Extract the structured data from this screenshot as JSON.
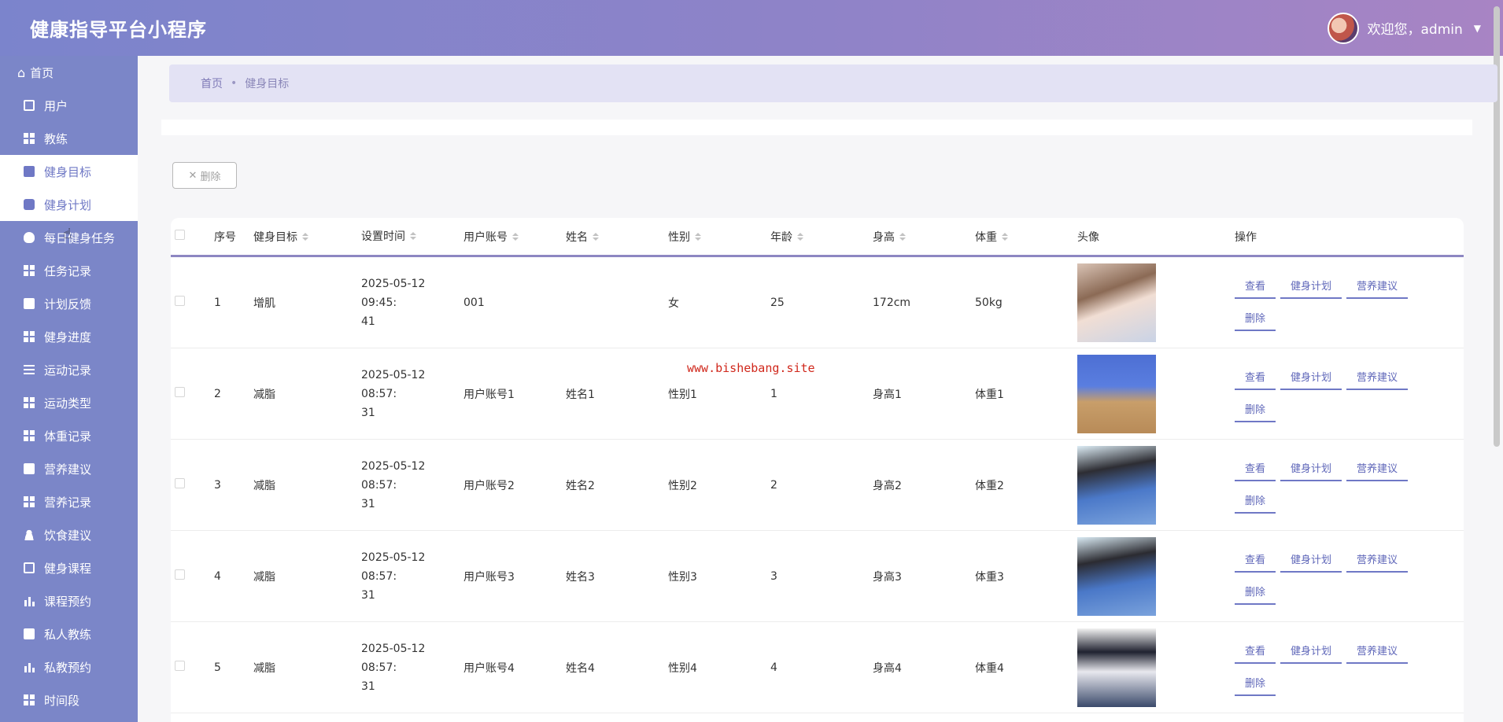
{
  "header": {
    "title": "健康指导平台小程序",
    "welcome": "欢迎您，admin"
  },
  "sidebar": {
    "home": "首页",
    "items": [
      {
        "label": "用户",
        "icon": "clipboard-icon"
      },
      {
        "label": "教练",
        "icon": "grid-icon"
      },
      {
        "label": "健身目标",
        "icon": "briefcase-icon"
      },
      {
        "label": "健身计划",
        "icon": "chat-icon"
      },
      {
        "label": "每日健身任务",
        "icon": "bulb-icon"
      },
      {
        "label": "任务记录",
        "icon": "grid-icon"
      },
      {
        "label": "计划反馈",
        "icon": "board-icon"
      },
      {
        "label": "健身进度",
        "icon": "grid-icon"
      },
      {
        "label": "运动记录",
        "icon": "list-icon"
      },
      {
        "label": "运动类型",
        "icon": "grid-icon"
      },
      {
        "label": "体重记录",
        "icon": "grid-icon"
      },
      {
        "label": "营养建议",
        "icon": "board-icon"
      },
      {
        "label": "营养记录",
        "icon": "grid-icon"
      },
      {
        "label": "饮食建议",
        "icon": "user-icon"
      },
      {
        "label": "健身课程",
        "icon": "clipboard-icon"
      },
      {
        "label": "课程预约",
        "icon": "bar-chart-icon"
      },
      {
        "label": "私人教练",
        "icon": "thumb-icon"
      },
      {
        "label": "私教预约",
        "icon": "book-icon"
      },
      {
        "label": "时间段",
        "icon": "grid-icon"
      }
    ]
  },
  "breadcrumb": {
    "home": "首页",
    "sep": "•",
    "current": "健身目标"
  },
  "toolbar": {
    "delete_icon": "✕",
    "delete_label": "删除"
  },
  "table": {
    "headers": [
      "序号",
      "健身目标",
      "设置时间",
      "用户账号",
      "姓名",
      "性别",
      "年龄",
      "身高",
      "体重",
      "头像",
      "操作"
    ],
    "rows": [
      {
        "idx": "1",
        "goal": "增肌",
        "time1": "2025-05-12 09:45:",
        "time2": "41",
        "account": "001",
        "name": "",
        "sex": "女",
        "age": "25",
        "height": "172cm",
        "weight": "50kg"
      },
      {
        "idx": "2",
        "goal": "减脂",
        "time1": "2025-05-12 08:57:",
        "time2": "31",
        "account": "用户账号1",
        "name": "姓名1",
        "sex": "性别1",
        "age": "1",
        "height": "身高1",
        "weight": "体重1"
      },
      {
        "idx": "3",
        "goal": "减脂",
        "time1": "2025-05-12 08:57:",
        "time2": "31",
        "account": "用户账号2",
        "name": "姓名2",
        "sex": "性别2",
        "age": "2",
        "height": "身高2",
        "weight": "体重2"
      },
      {
        "idx": "4",
        "goal": "减脂",
        "time1": "2025-05-12 08:57:",
        "time2": "31",
        "account": "用户账号3",
        "name": "姓名3",
        "sex": "性别3",
        "age": "3",
        "height": "身高3",
        "weight": "体重3"
      },
      {
        "idx": "5",
        "goal": "减脂",
        "time1": "2025-05-12 08:57:",
        "time2": "31",
        "account": "用户账号4",
        "name": "姓名4",
        "sex": "性别4",
        "age": "4",
        "height": "身高4",
        "weight": "体重4"
      }
    ],
    "ops": {
      "view": "查看",
      "plan": "健身计划",
      "nutrition": "营养建议",
      "delete": "删除"
    }
  },
  "watermark": "www.bishebang.site",
  "colors": {
    "accent": "#7b86c8",
    "link": "#5f67b9",
    "breadcrumb_bg": "#e3e2f4",
    "watermark": "#d0281c"
  }
}
